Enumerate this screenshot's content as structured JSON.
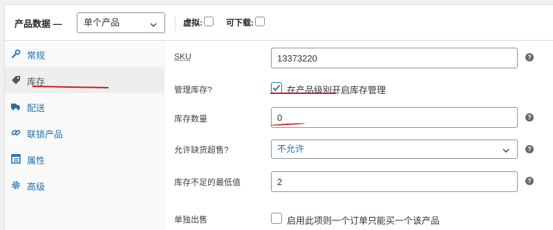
{
  "header": {
    "title": "产品数据 —",
    "product_type": "单个产品",
    "virtual_label": "虚拟:",
    "downloadable_label": "可下载:"
  },
  "tabs": [
    {
      "label": "常规",
      "icon": "wrench-icon"
    },
    {
      "label": "库存",
      "icon": "tag-icon"
    },
    {
      "label": "配送",
      "icon": "truck-icon"
    },
    {
      "label": "联锁产品",
      "icon": "link-icon"
    },
    {
      "label": "属性",
      "icon": "table-icon"
    },
    {
      "label": "高级",
      "icon": "gear-icon"
    }
  ],
  "active_tab": "库存",
  "fields": {
    "sku": {
      "label": "SKU",
      "value": "13373220"
    },
    "manage_stock": {
      "label": "管理库存?",
      "checkbox_label": "在产品级别开启库存管理",
      "checked": true
    },
    "stock_qty": {
      "label": "库存数量",
      "value": "0"
    },
    "backorders": {
      "label": "允许缺货超售?",
      "value": "不允许"
    },
    "low_stock": {
      "label": "库存不足的最低值",
      "value": "2"
    },
    "sold_individually": {
      "label": "单独出售",
      "checkbox_label": "启用此项则一个订单只能买一个该产品",
      "checked": false
    }
  },
  "help_glyph": "?",
  "colors": {
    "link": "#2271b1",
    "annotation": "#d0151f",
    "border": "#8c8f94"
  }
}
